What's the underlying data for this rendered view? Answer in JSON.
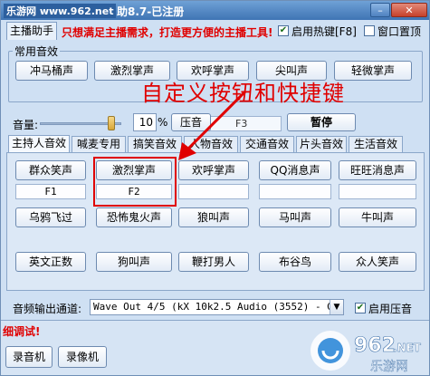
{
  "window": {
    "watermark": "乐游网 www.962.net",
    "title": "助8.7-已注册",
    "min_label": "–",
    "close_label": "✕"
  },
  "header": {
    "menu_tab": "主播助手",
    "promo": "只想满足主播需求，打造更方便的主播工具!",
    "hotkey_enable": {
      "label": "启用热键[F8]",
      "checked": true
    },
    "topmost": {
      "label": "窗口置顶",
      "checked": false
    }
  },
  "common_sounds": {
    "title": "常用音效",
    "buttons": [
      "冲马桶声",
      "激烈掌声",
      "欢呼掌声",
      "尖叫声",
      "轻微掌声"
    ]
  },
  "annotation": "自定义按钮和快捷键",
  "volume": {
    "label": "音量:",
    "value": "10",
    "unit": "%",
    "level_percent": 85,
    "compress_button": "压音",
    "hotkey_display": "F3",
    "pause_button": "暂停"
  },
  "tabs": [
    {
      "label": "主持人音效",
      "active": true
    },
    {
      "label": "喊麦专用",
      "active": false
    },
    {
      "label": "搞笑音效",
      "active": false
    },
    {
      "label": "人物音效",
      "active": false
    },
    {
      "label": "交通音效",
      "active": false
    },
    {
      "label": "片头音效",
      "active": false
    },
    {
      "label": "生活音效",
      "active": false
    }
  ],
  "panel": {
    "row1": [
      {
        "label": "群众笑声",
        "hotkey": "F1"
      },
      {
        "label": "激烈掌声",
        "hotkey": "F2"
      },
      {
        "label": "欢呼掌声",
        "hotkey": ""
      },
      {
        "label": "QQ消息声",
        "hotkey": ""
      },
      {
        "label": "旺旺消息声",
        "hotkey": ""
      }
    ],
    "row2": [
      "乌鸦飞过",
      "恐怖鬼火声",
      "狼叫声",
      "马叫声",
      "牛叫声"
    ],
    "row3": [
      "英文正数",
      "狗叫声",
      "鞭打男人",
      "布谷鸟",
      "众人笑声"
    ]
  },
  "output": {
    "label": "音频输出通道:",
    "device": "Wave Out 4/5 (kX 10k2.5 Audio (3552) - Gene",
    "compress": {
      "label": "启用压音",
      "checked": true
    }
  },
  "debug": {
    "label": "细调试!",
    "buttons": [
      "录音机",
      "录像机"
    ]
  },
  "site_logo": {
    "text": "962",
    "suffix": ".NET",
    "cn": "乐游网"
  },
  "colors": {
    "accent_red": "#e00000",
    "title_blue": "#3f74b4",
    "panel_blue": "#cfe0f3"
  }
}
